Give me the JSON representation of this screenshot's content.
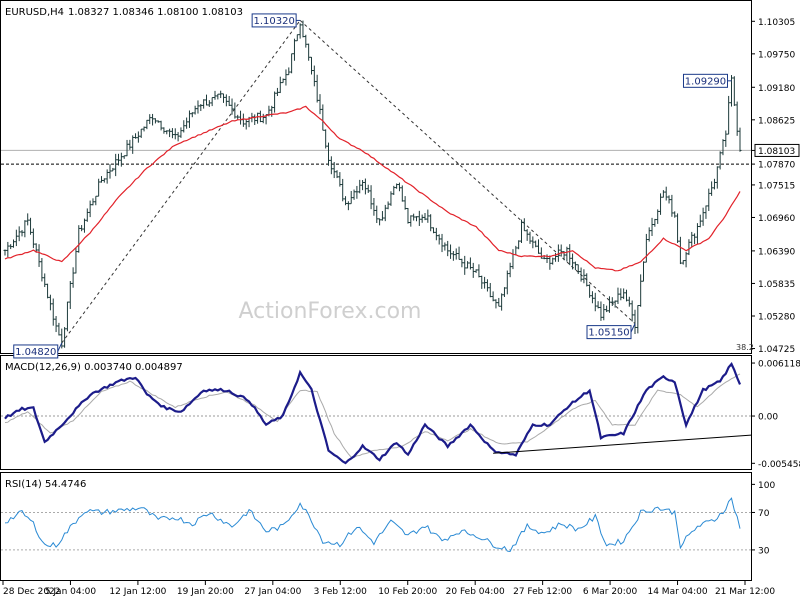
{
  "chart_data": [
    {
      "type": "candlestick",
      "title": "EURUSD,H4",
      "ohlc_label": "1.08327 1.08346 1.08100 1.08103",
      "ylim": [
        1.047,
        1.106
      ],
      "x_ticks": [
        "28 Dec 2022",
        "5 Jan 04:00",
        "12 Jan 12:00",
        "19 Jan 20:00",
        "27 Jan 04:00",
        "3 Feb 12:00",
        "10 Feb 20:00",
        "20 Feb 04:00",
        "27 Feb 12:00",
        "6 Mar 20:00",
        "14 Mar 04:00",
        "21 Mar 12:00"
      ],
      "y_ticks": [
        1.10305,
        1.0975,
        1.0918,
        1.08625,
        1.08103,
        1.0787,
        1.07515,
        1.0696,
        1.0639,
        1.05835,
        1.0528,
        1.04725
      ],
      "y_tick_labels": [
        "1.10305",
        "1.09750",
        "1.09180",
        "1.08625",
        "1.08103",
        "1.07870",
        "1.07515",
        "1.06960",
        "1.06390",
        "1.05835",
        "1.05280",
        "1.04725"
      ],
      "price_anchors": [
        [
          0,
          1.064
        ],
        [
          8,
          1.069
        ],
        [
          18,
          1.051
        ],
        [
          20,
          1.0482
        ],
        [
          26,
          1.067
        ],
        [
          34,
          1.076
        ],
        [
          44,
          1.082
        ],
        [
          52,
          1.087
        ],
        [
          60,
          1.083
        ],
        [
          68,
          1.089
        ],
        [
          76,
          1.09
        ],
        [
          84,
          1.086
        ],
        [
          92,
          1.087
        ],
        [
          100,
          1.095
        ],
        [
          104,
          1.1032
        ],
        [
          110,
          1.09
        ],
        [
          114,
          1.08
        ],
        [
          120,
          1.072
        ],
        [
          126,
          1.076
        ],
        [
          132,
          1.069
        ],
        [
          138,
          1.076
        ],
        [
          142,
          1.069
        ],
        [
          148,
          1.07
        ],
        [
          156,
          1.064
        ],
        [
          166,
          1.06
        ],
        [
          174,
          1.054
        ],
        [
          182,
          1.068
        ],
        [
          190,
          1.062
        ],
        [
          198,
          1.064
        ],
        [
          204,
          1.059
        ],
        [
          210,
          1.053
        ],
        [
          218,
          1.057
        ],
        [
          222,
          1.0515
        ],
        [
          226,
          1.066
        ],
        [
          232,
          1.074
        ],
        [
          236,
          1.07
        ],
        [
          238,
          1.062
        ],
        [
          244,
          1.068
        ],
        [
          250,
          1.076
        ],
        [
          254,
          1.084
        ],
        [
          256,
          1.0929
        ],
        [
          259,
          1.081
        ]
      ],
      "moving_average_anchors": [
        [
          0,
          1.0625
        ],
        [
          10,
          1.064
        ],
        [
          20,
          1.062
        ],
        [
          30,
          1.067
        ],
        [
          40,
          1.073
        ],
        [
          50,
          1.078
        ],
        [
          60,
          1.082
        ],
        [
          70,
          1.084
        ],
        [
          80,
          1.086
        ],
        [
          92,
          1.087
        ],
        [
          100,
          1.0875
        ],
        [
          106,
          1.0885
        ],
        [
          112,
          1.086
        ],
        [
          118,
          1.083
        ],
        [
          126,
          1.081
        ],
        [
          136,
          1.0775
        ],
        [
          146,
          1.074
        ],
        [
          156,
          1.0705
        ],
        [
          166,
          1.068
        ],
        [
          174,
          1.064
        ],
        [
          182,
          1.063
        ],
        [
          192,
          1.063
        ],
        [
          200,
          1.064
        ],
        [
          208,
          1.061
        ],
        [
          216,
          1.0605
        ],
        [
          224,
          1.062
        ],
        [
          232,
          1.066
        ],
        [
          240,
          1.064
        ],
        [
          248,
          1.066
        ],
        [
          254,
          1.07
        ],
        [
          259,
          1.074
        ]
      ],
      "trendline": [
        [
          20,
          1.0482
        ],
        [
          104,
          1.1032
        ],
        [
          222,
          1.0515
        ]
      ],
      "support_line": 1.0787,
      "last_price": 1.08103,
      "annotations": [
        {
          "text": "1.10320",
          "index": 104,
          "value": 1.1032,
          "anchor": "top"
        },
        {
          "text": "1.04820",
          "index": 20,
          "value": 1.0482,
          "anchor": "bottom"
        },
        {
          "text": "1.05150",
          "index": 222,
          "value": 1.0515,
          "anchor": "bottom"
        },
        {
          "text": "1.09290",
          "index": 256,
          "value": 1.0929,
          "anchor": "top"
        }
      ],
      "fib_label": "38.2",
      "watermark": "ActionForex.com",
      "bar_count": 260
    },
    {
      "type": "line",
      "title": "MACD(12,26,9) 0.003740 0.004897",
      "ylim": [
        -0.006,
        0.0067
      ],
      "y_ticks": [
        0.006118,
        0.0,
        -0.005458
      ],
      "y_tick_labels": [
        "0.006118",
        "0.00",
        "-0.005458"
      ],
      "main_anchors": [
        [
          0,
          -0.0002
        ],
        [
          6,
          0.0008
        ],
        [
          10,
          0.0009
        ],
        [
          14,
          -0.003
        ],
        [
          20,
          -0.001
        ],
        [
          30,
          0.0025
        ],
        [
          40,
          0.004
        ],
        [
          46,
          0.0045
        ],
        [
          50,
          0.0025
        ],
        [
          56,
          0.001
        ],
        [
          62,
          0.0005
        ],
        [
          70,
          0.003
        ],
        [
          78,
          0.003
        ],
        [
          86,
          0.0018
        ],
        [
          92,
          -0.001
        ],
        [
          98,
          0.0
        ],
        [
          104,
          0.005
        ],
        [
          108,
          0.003
        ],
        [
          114,
          -0.004
        ],
        [
          120,
          -0.0055
        ],
        [
          126,
          -0.0035
        ],
        [
          132,
          -0.005
        ],
        [
          138,
          -0.003
        ],
        [
          142,
          -0.0045
        ],
        [
          148,
          -0.001
        ],
        [
          156,
          -0.0035
        ],
        [
          164,
          -0.001
        ],
        [
          172,
          -0.004
        ],
        [
          180,
          -0.0045
        ],
        [
          186,
          -0.001
        ],
        [
          192,
          -0.001
        ],
        [
          198,
          0.001
        ],
        [
          206,
          0.003
        ],
        [
          210,
          -0.0025
        ],
        [
          218,
          -0.002
        ],
        [
          226,
          0.003
        ],
        [
          232,
          0.0045
        ],
        [
          236,
          0.004
        ],
        [
          240,
          -0.001
        ],
        [
          246,
          0.003
        ],
        [
          252,
          0.004
        ],
        [
          256,
          0.006
        ],
        [
          259,
          0.0037
        ]
      ],
      "signal_anchors": [
        [
          0,
          -0.0008
        ],
        [
          8,
          0.0005
        ],
        [
          16,
          -0.002
        ],
        [
          24,
          -0.0005
        ],
        [
          34,
          0.0028
        ],
        [
          44,
          0.004
        ],
        [
          52,
          0.0025
        ],
        [
          60,
          0.001
        ],
        [
          68,
          0.002
        ],
        [
          78,
          0.0028
        ],
        [
          88,
          0.0012
        ],
        [
          96,
          -0.0006
        ],
        [
          104,
          0.003
        ],
        [
          110,
          0.0028
        ],
        [
          116,
          -0.002
        ],
        [
          122,
          -0.0048
        ],
        [
          130,
          -0.004
        ],
        [
          140,
          -0.0035
        ],
        [
          148,
          -0.0018
        ],
        [
          156,
          -0.0028
        ],
        [
          164,
          -0.0015
        ],
        [
          174,
          -0.0032
        ],
        [
          184,
          -0.003
        ],
        [
          192,
          -0.0012
        ],
        [
          200,
          0.0008
        ],
        [
          208,
          0.0018
        ],
        [
          214,
          -0.001
        ],
        [
          222,
          -0.001
        ],
        [
          230,
          0.003
        ],
        [
          238,
          0.0025
        ],
        [
          244,
          0.001
        ],
        [
          252,
          0.0035
        ],
        [
          259,
          0.0049
        ]
      ],
      "trendline": [
        [
          172,
          -0.0043
        ],
        [
          259,
          -0.0022
        ]
      ]
    },
    {
      "type": "line",
      "title": "RSI(14) 54.4746",
      "ylim": [
        0,
        110
      ],
      "y_ticks": [
        100,
        70,
        30
      ],
      "y_tick_labels": [
        "100",
        "70",
        "30"
      ],
      "levels": [
        70,
        30
      ],
      "rsi_anchors": [
        [
          0,
          60
        ],
        [
          6,
          70
        ],
        [
          10,
          58
        ],
        [
          14,
          35
        ],
        [
          18,
          35
        ],
        [
          22,
          50
        ],
        [
          28,
          72
        ],
        [
          34,
          70
        ],
        [
          40,
          72
        ],
        [
          48,
          75
        ],
        [
          54,
          62
        ],
        [
          60,
          65
        ],
        [
          66,
          58
        ],
        [
          72,
          70
        ],
        [
          80,
          55
        ],
        [
          86,
          72
        ],
        [
          92,
          50
        ],
        [
          98,
          55
        ],
        [
          104,
          80
        ],
        [
          108,
          62
        ],
        [
          112,
          40
        ],
        [
          118,
          36
        ],
        [
          124,
          55
        ],
        [
          130,
          38
        ],
        [
          136,
          60
        ],
        [
          142,
          45
        ],
        [
          148,
          56
        ],
        [
          154,
          40
        ],
        [
          160,
          50
        ],
        [
          166,
          46
        ],
        [
          172,
          36
        ],
        [
          178,
          30
        ],
        [
          184,
          55
        ],
        [
          190,
          48
        ],
        [
          196,
          58
        ],
        [
          202,
          52
        ],
        [
          208,
          65
        ],
        [
          212,
          35
        ],
        [
          218,
          40
        ],
        [
          224,
          70
        ],
        [
          230,
          75
        ],
        [
          236,
          70
        ],
        [
          238,
          35
        ],
        [
          244,
          55
        ],
        [
          250,
          62
        ],
        [
          254,
          75
        ],
        [
          256,
          85
        ],
        [
          259,
          54
        ]
      ]
    }
  ]
}
